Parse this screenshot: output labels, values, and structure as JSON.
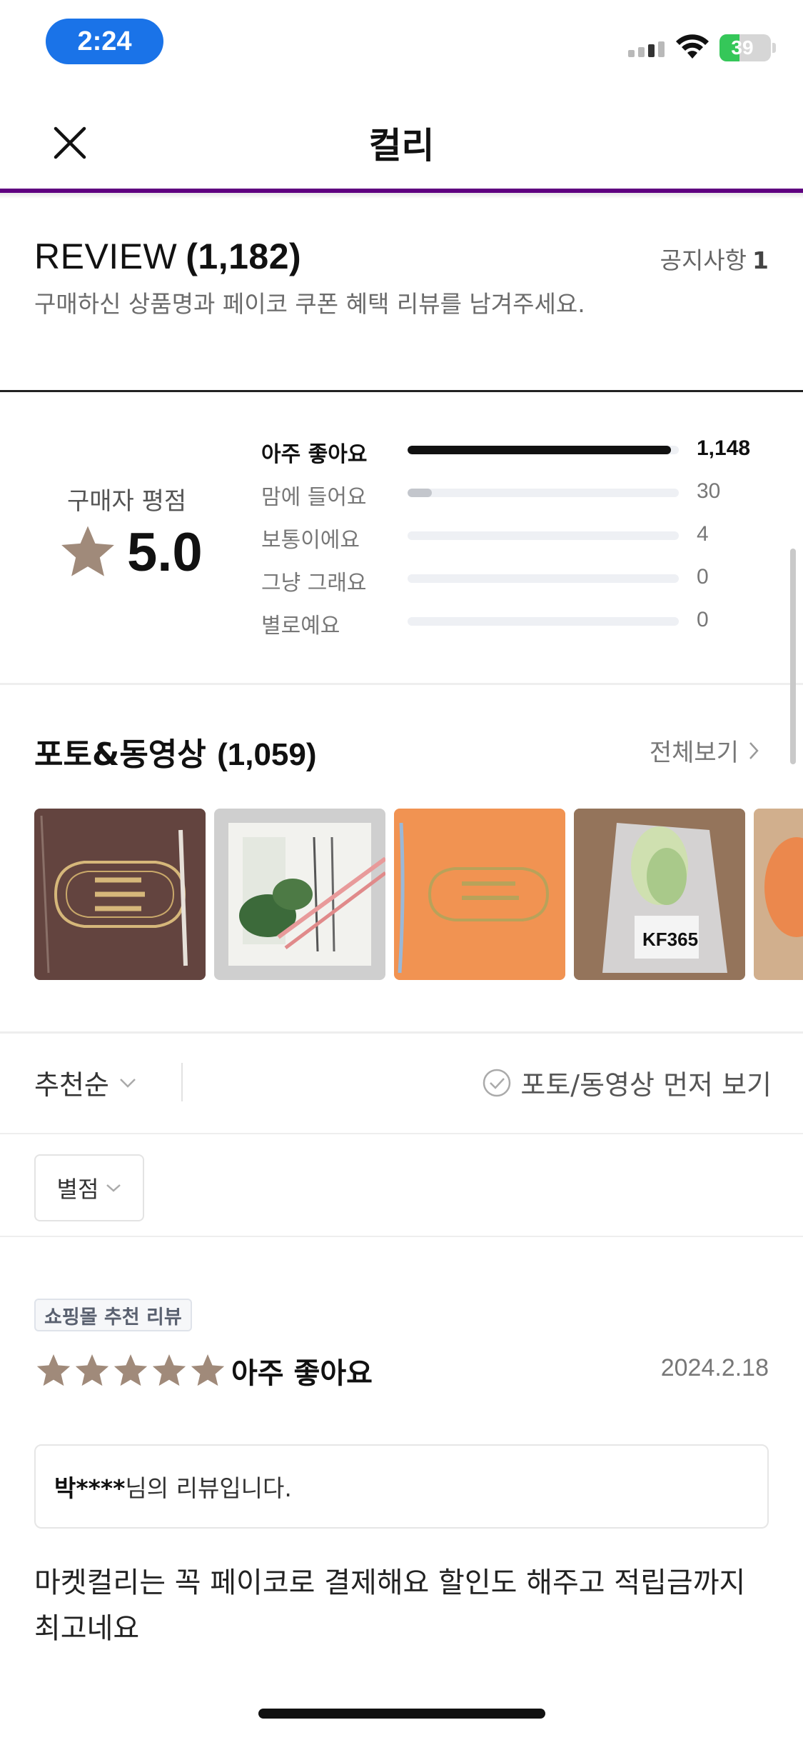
{
  "status_bar": {
    "time": "2:24",
    "battery": "39"
  },
  "nav": {
    "title": "컬리"
  },
  "review_header": {
    "title": "REVIEW",
    "count": "(1,182)",
    "notice_label": "공지사항",
    "notice_count": "1",
    "description": "구매하신 상품명과 페이코 쿠폰 혜택 리뷰를 남겨주세요."
  },
  "rating": {
    "label": "구매자 평점",
    "score": "5.0",
    "distribution": [
      {
        "label": "아주 좋아요",
        "count": "1,148",
        "fraction": 0.971
      },
      {
        "label": "맘에 들어요",
        "count": "30",
        "fraction": 0.09
      },
      {
        "label": "보통이에요",
        "count": "4",
        "fraction": 0
      },
      {
        "label": "그냥 그래요",
        "count": "0",
        "fraction": 0
      },
      {
        "label": "별로예요",
        "count": "0",
        "fraction": 0
      }
    ]
  },
  "photos": {
    "title": "포토&동영상",
    "count": "(1,059)",
    "see_all": "전체보기",
    "thumbnail_text": [
      "KF365"
    ]
  },
  "sort": {
    "selected": "추천순",
    "photo_first_label": "포토/동영상 먼저 보기",
    "filter_label": "별점"
  },
  "review": {
    "badge": "쇼핑몰 추천 리뷰",
    "rating_text": "아주 좋아요",
    "stars": 5,
    "date": "2024.2.18",
    "author_name": "박****",
    "author_suffix": "님의 리뷰입니다.",
    "body": "마켓컬리는 꼭 페이코로 결제해요 할인도 해주고 적립금까지 최고네요"
  },
  "colors": {
    "brand_purple": "#5f0080",
    "star": "#a08a7a",
    "time_pill": "#1a73e8",
    "battery_green": "#35c759"
  }
}
